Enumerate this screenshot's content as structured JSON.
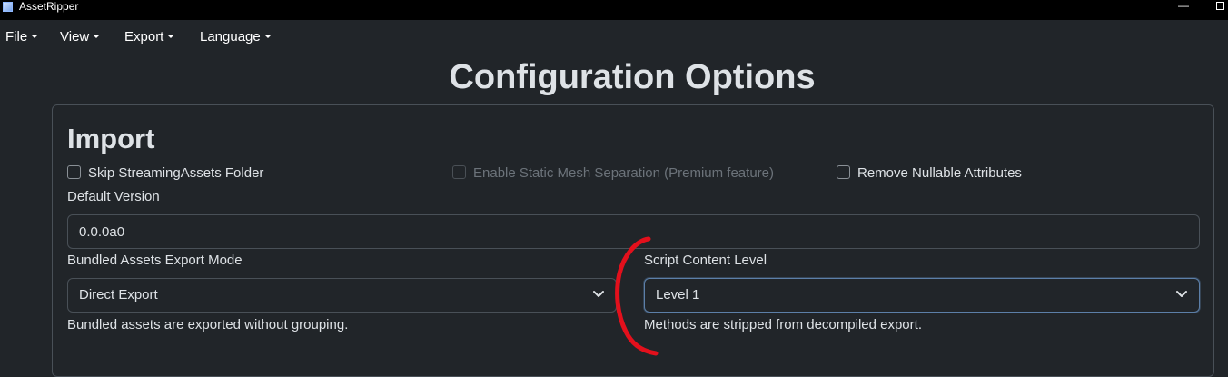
{
  "window": {
    "title": "AssetRipper",
    "minimize_glyph": "—"
  },
  "menu": [
    {
      "label": "File"
    },
    {
      "label": "View"
    },
    {
      "label": "Export"
    },
    {
      "label": "Language"
    }
  ],
  "page": {
    "title": "Configuration Options"
  },
  "import_section": {
    "title": "Import",
    "checkboxes": [
      {
        "label": "Skip StreamingAssets Folder",
        "checked": false,
        "disabled": false
      },
      {
        "label": "Enable Static Mesh Separation (Premium feature)",
        "checked": false,
        "disabled": true
      },
      {
        "label": "Remove Nullable Attributes",
        "checked": false,
        "disabled": false
      }
    ],
    "default_version": {
      "label": "Default Version",
      "value": "0.0.0a0"
    },
    "bundled_assets": {
      "label": "Bundled Assets Export Mode",
      "selected": "Direct Export",
      "help": "Bundled assets are exported without grouping."
    },
    "script_content": {
      "label": "Script Content Level",
      "selected": "Level 1",
      "help": "Methods are stripped from decompiled export."
    }
  },
  "colors": {
    "background": "#212529",
    "text": "#dee2e6",
    "border": "#495057",
    "annotation": "#e3101c"
  },
  "icons": {
    "app": "app-icon",
    "dropdown": "chevron-down-icon",
    "menu_caret": "caret-down-icon"
  }
}
